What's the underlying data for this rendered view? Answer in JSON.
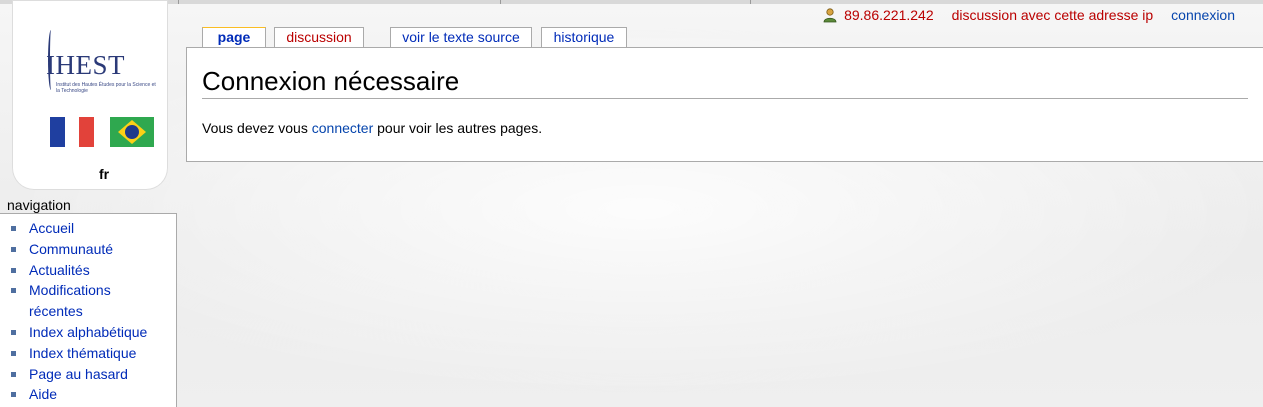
{
  "personal": {
    "ip": "89.86.221.242",
    "talk": "discussion avec cette adresse ip",
    "login": "connexion"
  },
  "logo": {
    "name": "IHEST",
    "tagline": "Institut des Hautes Études pour la Science et la Technologie",
    "language": "fr"
  },
  "tabs": [
    {
      "label": "page",
      "selected": true
    },
    {
      "label": "discussion",
      "new": true
    },
    {
      "label": "voir le texte source"
    },
    {
      "label": "historique"
    }
  ],
  "page": {
    "title": "Connexion nécessaire",
    "text_before": "Vous devez vous ",
    "link": "connecter",
    "text_after": " pour voir les autres pages."
  },
  "navigation": {
    "title": "navigation",
    "items": [
      {
        "label": "Accueil"
      },
      {
        "label": "Communauté"
      },
      {
        "label": "Actualités"
      },
      {
        "label": "Modifications récentes"
      },
      {
        "label": "Index alphabétique"
      },
      {
        "label": "Index thématique"
      },
      {
        "label": "Page au hasard"
      },
      {
        "label": "Aide"
      }
    ]
  },
  "colors": {
    "link": "#0645ad",
    "new_link": "#ba0000",
    "tab_selected_border": "#fabd23"
  }
}
